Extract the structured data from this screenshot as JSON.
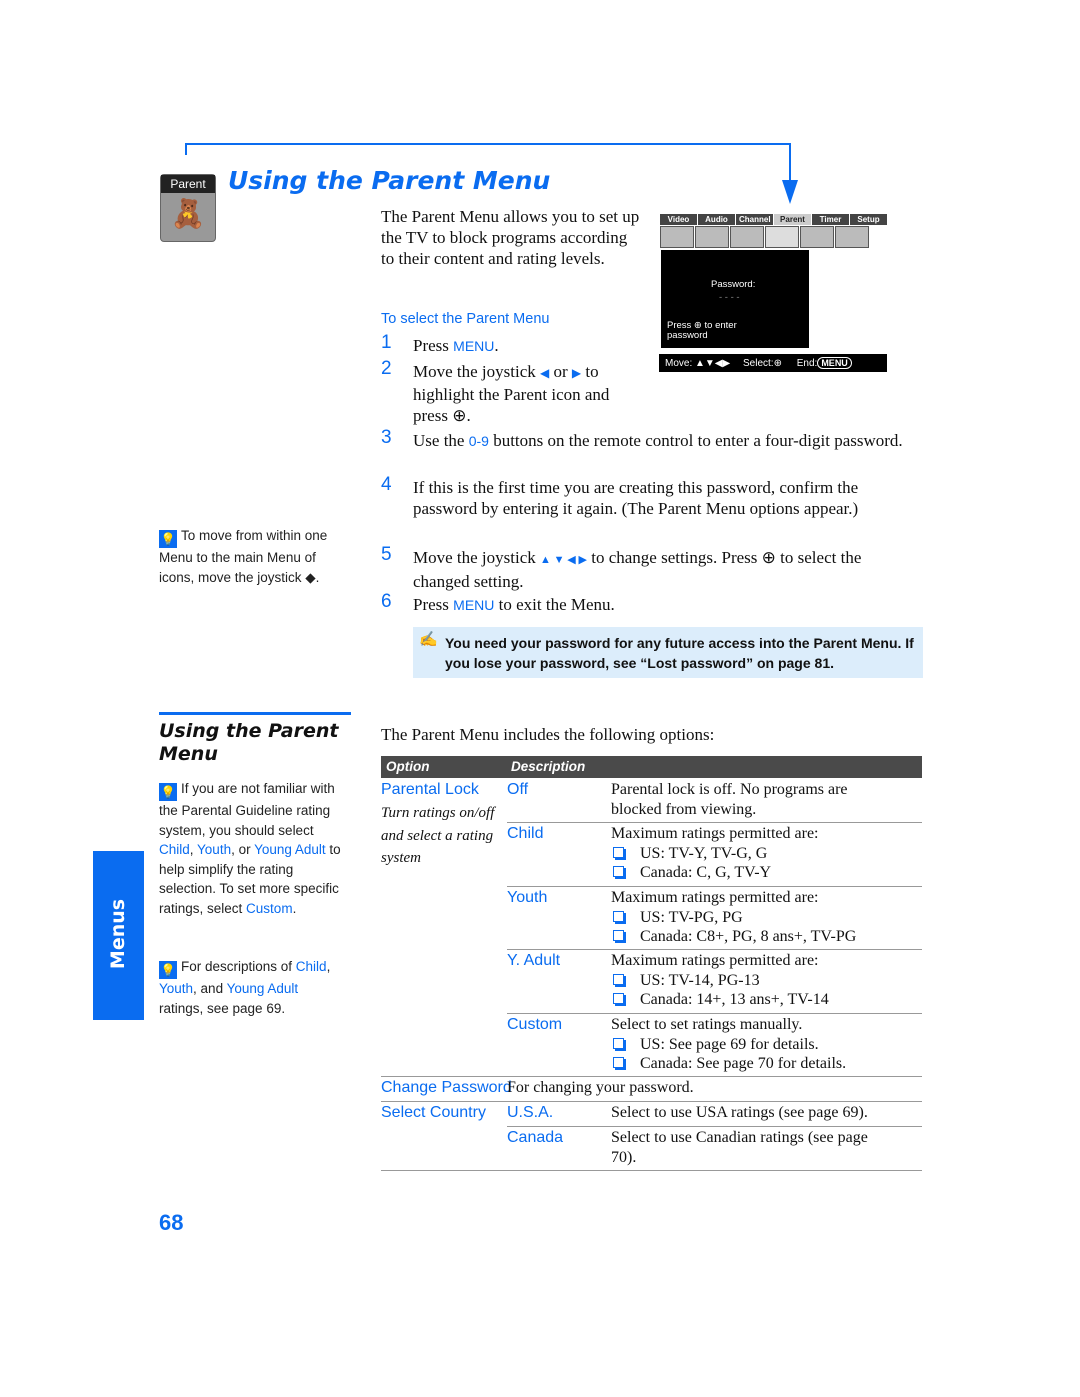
{
  "header": {
    "icon_label": "Parent",
    "title": "Using the Parent Menu"
  },
  "intro": "The Parent Menu allows you to set up the TV to block programs according to their content and rating levels.",
  "procedure": {
    "heading": "To select the Parent Menu",
    "steps": [
      {
        "n": "1",
        "parts": [
          "Press ",
          "MENU",
          "."
        ]
      },
      {
        "n": "2",
        "parts": [
          "Move the joystick ",
          "◆",
          " or ",
          "◆",
          " to highlight the Parent icon and press ",
          "⊕",
          "."
        ]
      },
      {
        "n": "3",
        "parts": [
          "Use the ",
          "0-9",
          " buttons on the remote control to enter a four-digit password."
        ]
      },
      {
        "n": "4",
        "text": "If this is the first time you are creating this password, confirm the password by entering it again. (The Parent Menu options appear.)"
      },
      {
        "n": "5",
        "parts": [
          "Move the joystick ",
          "▲ ▼ ◀ ▶",
          " to change settings. Press ",
          "⊕",
          " to select the changed setting."
        ]
      },
      {
        "n": "6",
        "parts": [
          "Press ",
          "MENU",
          " to exit the Menu."
        ]
      }
    ]
  },
  "tv_screen": {
    "tabs": [
      "Video",
      "Audio",
      "Channel",
      "Parent",
      "Timer",
      "Setup"
    ],
    "selected_tab": "Parent",
    "password_label": "Password:",
    "password_mask": "- - - -",
    "hint": "Press ⊕ to enter password",
    "move": "Move:",
    "select": "Select:",
    "end": "End:",
    "menu": "MENU"
  },
  "note": "You need your password for any future access into the Parent Menu. If you lose your password, see “Lost password” on page 81.",
  "tip1": {
    "text": "To move from within one Menu to the main Menu of icons, move the joystick ◆."
  },
  "sidebar": {
    "heading": "Using the Parent Menu",
    "tip2": [
      "If you are not familiar with the Parental Guideline rating system, you should select ",
      "Child",
      ", ",
      "Youth",
      ", or ",
      "Young Adult",
      " to help simplify the rating selection. To set more specific ratings, select ",
      "Custom",
      "."
    ],
    "tip3": [
      "For descriptions of ",
      "Child",
      ", ",
      "Youth",
      ", and ",
      "Young Adult",
      " ratings, see page 69."
    ]
  },
  "side_tab": "Menus",
  "options_intro": "The Parent Menu includes the following options:",
  "table": {
    "headers": [
      "Option",
      "Description"
    ],
    "parental_lock": "Parental Lock",
    "parental_lock_note": "Turn ratings on/off and select a rating system",
    "rows": [
      {
        "value": "Off",
        "desc": "Parental lock is off. No programs are blocked from viewing.",
        "bullets": []
      },
      {
        "value": "Child",
        "desc": "Maximum ratings permitted are:",
        "bullets": [
          "US: TV-Y, TV-G, G",
          "Canada: C, G, TV-Y"
        ]
      },
      {
        "value": "Youth",
        "desc": "Maximum ratings permitted are:",
        "bullets": [
          "US: TV-PG, PG",
          "Canada: C8+, PG, 8 ans+, TV-PG"
        ]
      },
      {
        "value": "Y. Adult",
        "desc": "Maximum ratings permitted are:",
        "bullets": [
          "US: TV-14, PG-13",
          "Canada: 14+, 13 ans+, TV-14"
        ]
      },
      {
        "value": "Custom",
        "desc": "Select to set ratings manually.",
        "bullets": [
          "US: See page 69 for details.",
          "Canada: See page 70 for details."
        ]
      }
    ],
    "change_password": "Change Password",
    "change_password_desc": "For changing your password.",
    "select_country": "Select Country",
    "country_rows": [
      {
        "value": "U.S.A.",
        "desc": "Select to use USA ratings (see page 69)."
      },
      {
        "value": "Canada",
        "desc": "Select to use Canadian ratings (see page 70)."
      }
    ]
  },
  "page_number": "68",
  "colors": {
    "accent": "#0a6cf0",
    "note_bg": "#dcedfb",
    "table_header": "#4a4a4a"
  }
}
